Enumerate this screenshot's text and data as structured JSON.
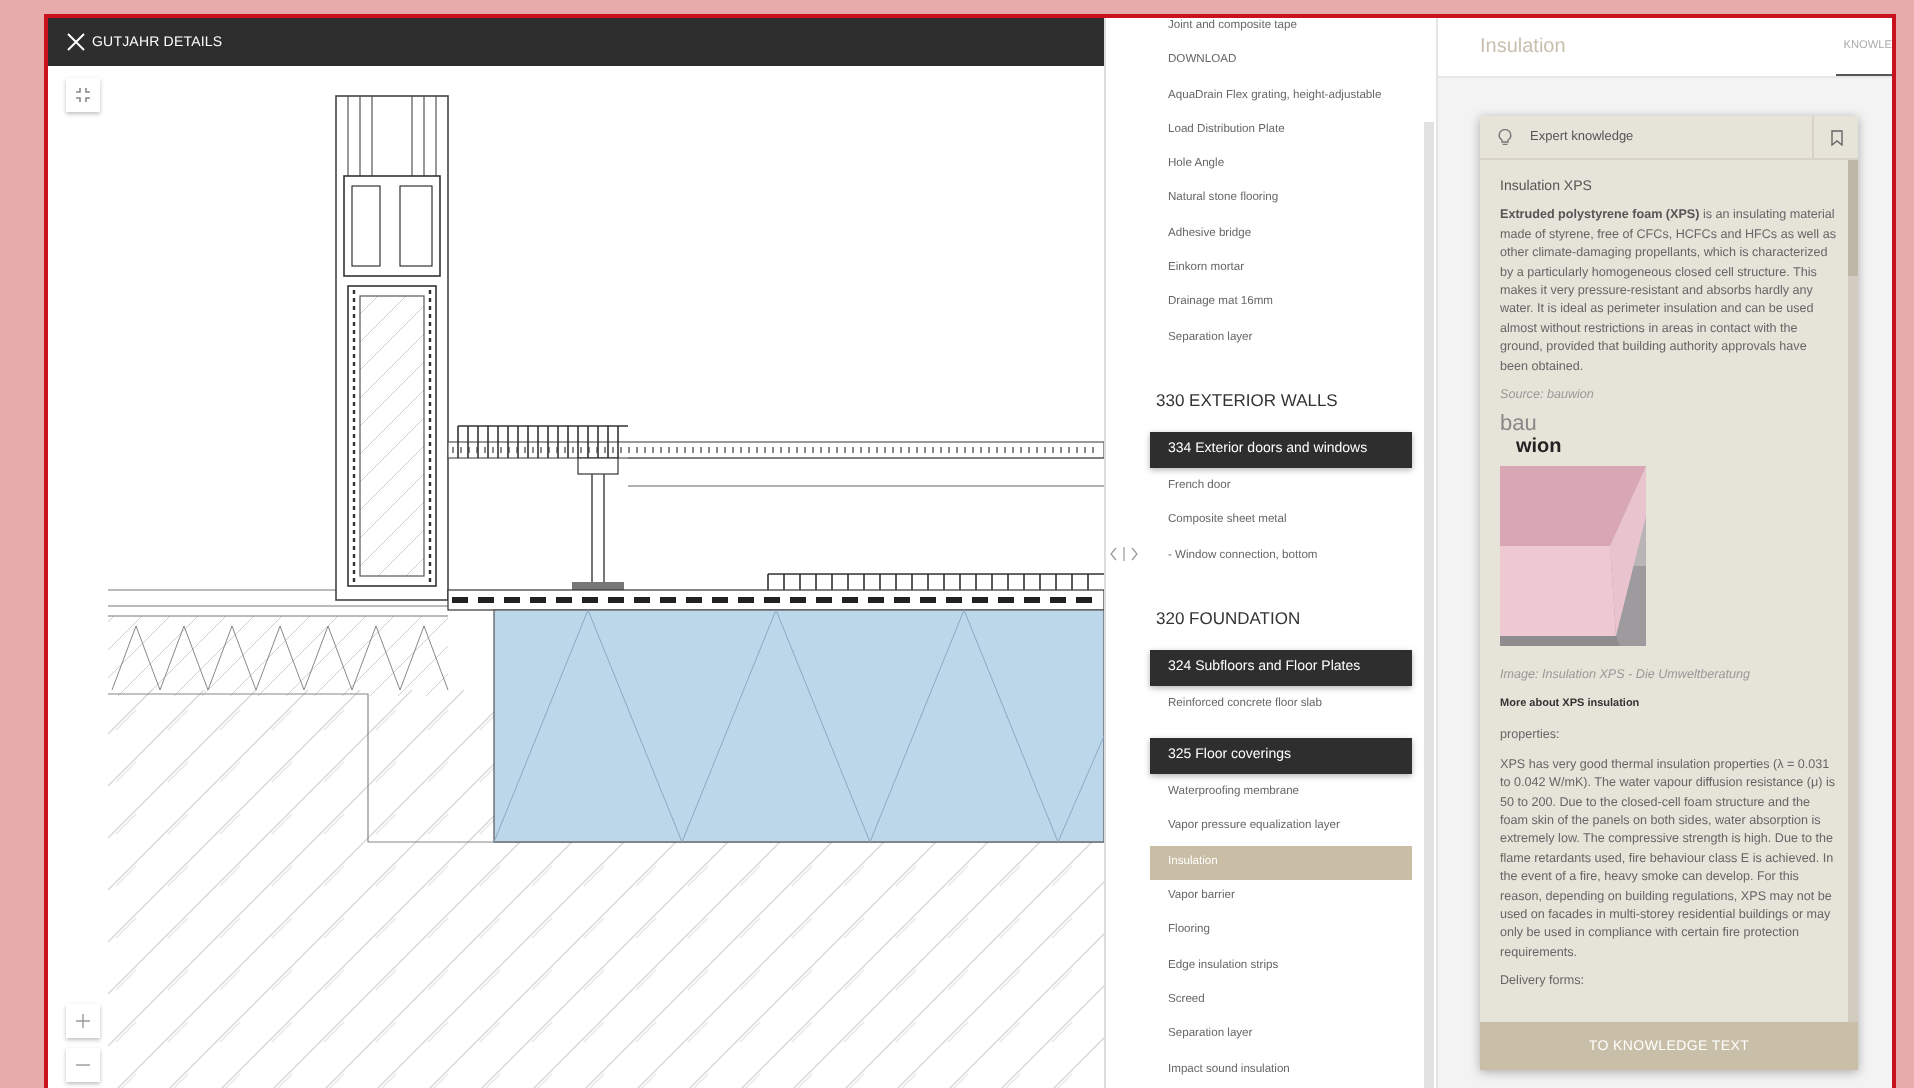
{
  "window": {
    "title": "GUTJAHR DETAILS"
  },
  "list": {
    "top_items": [
      {
        "label": "Joint and composite tape",
        "selected": false
      },
      {
        "label": "DOWNLOAD",
        "selected": false
      },
      {
        "label": "AquaDrain Flex grating, height-adjustable",
        "selected": false
      },
      {
        "label": "Load Distribution Plate",
        "selected": false
      },
      {
        "label": "Hole Angle",
        "selected": false
      },
      {
        "label": "Natural stone flooring",
        "selected": false
      },
      {
        "label": "Adhesive bridge",
        "selected": false
      },
      {
        "label": "Einkorn mortar",
        "selected": false
      },
      {
        "label": "Drainage mat 16mm",
        "selected": false
      },
      {
        "label": "Separation layer",
        "selected": false
      }
    ],
    "groups": [
      {
        "heading": "330 EXTERIOR WALLS",
        "sections": [
          {
            "title": "334 Exterior doors and windows",
            "items": [
              {
                "label": "French door",
                "selected": false
              },
              {
                "label": "Composite sheet metal",
                "selected": false
              },
              {
                "label": "- Window connection, bottom",
                "selected": false
              }
            ]
          }
        ]
      },
      {
        "heading": "320 FOUNDATION",
        "sections": [
          {
            "title": "324 Subfloors and Floor Plates",
            "items": [
              {
                "label": "Reinforced concrete floor slab",
                "selected": false
              }
            ]
          },
          {
            "title": "325 Floor coverings",
            "items": [
              {
                "label": "Waterproofing membrane",
                "selected": false
              },
              {
                "label": "Vapor pressure equalization layer",
                "selected": false
              },
              {
                "label": "Insulation",
                "selected": true
              },
              {
                "label": "Vapor barrier",
                "selected": false
              },
              {
                "label": "Flooring",
                "selected": false
              },
              {
                "label": "Edge insulation strips",
                "selected": false
              },
              {
                "label": "Screed",
                "selected": false
              },
              {
                "label": "Separation layer",
                "selected": false
              },
              {
                "label": "Impact sound insulation",
                "selected": false
              }
            ]
          }
        ]
      }
    ]
  },
  "detail": {
    "title": "Insulation",
    "tabs": [
      {
        "label": "KNOWLE",
        "selected": true
      }
    ],
    "card": {
      "header": "Expert knowledge",
      "button": "TO KNOWLEDGE TEXT",
      "blocks": [
        {
          "kind": "heading",
          "text": "Insulation XPS"
        },
        {
          "kind": "paragraph",
          "text": "**Extruded polystyrene foam (XPS)** is an insulating material made of styrene, free of CFCs, HCFCs and HFCs as well as other climate-damaging propellants, which is characterized by a particularly homogeneous closed cell structure. This makes it very pressure-resistant and absorbs hardly any water. It is ideal as perimeter insulation and can be used almost without restrictions in areas in contact with the ground, provided that building authority approvals have been obtained."
        },
        {
          "kind": "source",
          "text": "Source: bauwion"
        },
        {
          "kind": "logo",
          "lines": [
            "bau",
            "wion"
          ]
        },
        {
          "kind": "picture"
        },
        {
          "kind": "caption",
          "text": "Image: Insulation XPS - Die Umweltberatung"
        },
        {
          "kind": "link",
          "text": "More about XPS insulation"
        },
        {
          "kind": "label",
          "text": "properties:"
        },
        {
          "kind": "paragraph",
          "text": "XPS has very good thermal insulation properties (λ = 0.031 to 0.042 W/mK). The water vapour diffusion resistance (μ) is 50 to 200. Due to the closed-cell foam structure and the foam skin of the panels on both sides, water absorption is extremely low. The compressive strength is high. Due to the flame retardants used, fire behaviour class E is achieved. In the event of a fire, heavy smoke can develop. For this reason, depending on building regulations, XPS may not be used on facades in multi-storey residential buildings or may only be used in compliance with certain fire protection requirements."
        },
        {
          "kind": "label",
          "text": "Delivery forms:"
        }
      ]
    }
  }
}
